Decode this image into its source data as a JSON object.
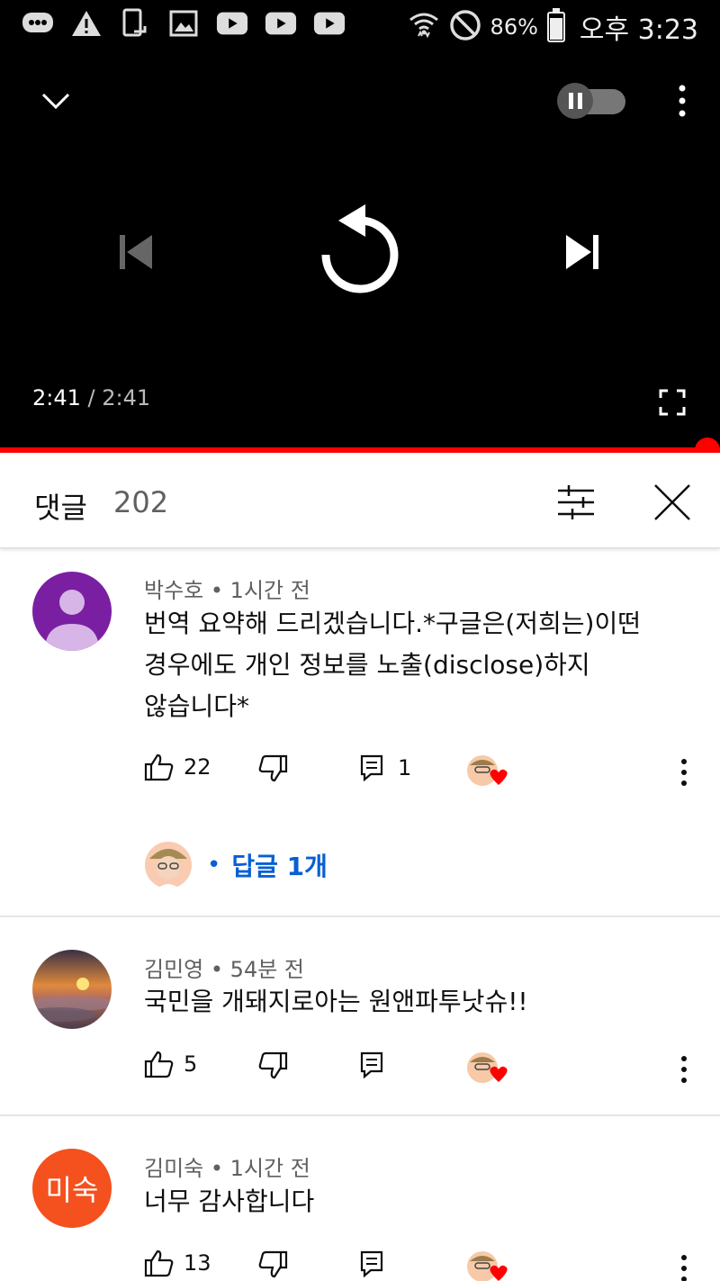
{
  "status_bar": {
    "battery": "86%",
    "time": "오후 3:23",
    "battery_level": 0.86,
    "icons": [
      "chat-icon",
      "warning-icon",
      "screen-share-icon",
      "gallery-icon",
      "youtube-icon",
      "youtube-icon",
      "youtube-icon",
      "wifi-icon",
      "dnd-icon"
    ]
  },
  "player": {
    "current_time": "2:41",
    "separator": "/",
    "duration": "2:41",
    "progress": 1.0,
    "accent_color": "#ff0000"
  },
  "comments_panel": {
    "title": "댓글",
    "count": "202"
  },
  "comments": [
    {
      "author": "박수호",
      "time": "1시간 전",
      "text_lines": [
        "번역 요약해 드리겠습니다.*구글은(저희는)이떤",
        "경우에도 개인 정보를 노출(disclose)하지",
        "않습니다*"
      ],
      "likes": "22",
      "replies_count": "1",
      "replies_label": "답글 1개"
    },
    {
      "author": "김민영",
      "time": "54분 전",
      "text_lines": [
        "국민을 개돼지로아는 원앤파투낫슈!!"
      ],
      "likes": "5"
    },
    {
      "author": "김미숙",
      "time": "1시간 전",
      "text_lines": [
        "너무 감사합니다"
      ],
      "likes": "13",
      "avatar_text": "미숙",
      "avatar_color": "#f4511e"
    }
  ]
}
